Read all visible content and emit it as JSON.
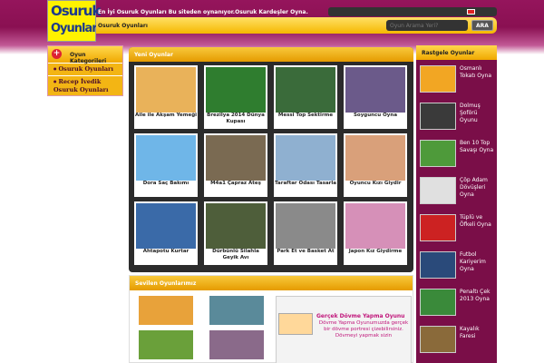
{
  "header": {
    "logo_line1": "Osuruk",
    "logo_line2": "Oyunları",
    "tagline": "En İyi Osuruk Oyunları Bu siteden oynanıyor.Osuruk Kardeşler Oyna.",
    "nav_home": "Osuruk Oyunları",
    "search_placeholder": "Oyun Arama Yeri?",
    "search_button": "ARA"
  },
  "left_sidebar": {
    "title": "Oyun Kategorileri",
    "items": [
      "Osuruk Oyunları",
      "Recep İvedik Osuruk Oyunları"
    ]
  },
  "new_games": {
    "title": "Yeni Oyunlar",
    "games": [
      {
        "name": "Aile ile Akşam Yemeği",
        "color": "#e9b25a"
      },
      {
        "name": "Brezilya 2014 Dünya Kupası",
        "color": "#2f7d2f"
      },
      {
        "name": "Messi Top Sektirme",
        "color": "#3a6b3a"
      },
      {
        "name": "Soyguncu Oyna",
        "color": "#6b5a8a"
      },
      {
        "name": "Dora Saç Bakımı",
        "color": "#6fb6e8"
      },
      {
        "name": "M4a1 Çapraz Ateş",
        "color": "#7a6a52"
      },
      {
        "name": "Taraftar Odası Tasarla",
        "color": "#8fb0d0"
      },
      {
        "name": "Oyuncu Kızı Giydir",
        "color": "#d9a07a"
      },
      {
        "name": "Ahtapotu Kurtar",
        "color": "#3a6aa8"
      },
      {
        "name": "Dürbünlü Silahla Geyik Avı",
        "color": "#4e5e3a"
      },
      {
        "name": "Park Et ve Basket At",
        "color": "#8a8a8a"
      },
      {
        "name": "Japon Kız Giydirme",
        "color": "#d690b8"
      }
    ]
  },
  "popular": {
    "title": "Sevilen Oyunlarımız",
    "feature_title": "Gerçek Dövme Yapma Oyunu",
    "feature_desc": "Dövme Yapma Oyunumuzda gerçek bir dövme portresi çizebilirsiniz. Dövmeyi yapmak sizin"
  },
  "right_sidebar": {
    "title": "Rastgele Oyunlar",
    "items": [
      {
        "name": "Osmanlı Tokatı Oyna",
        "color": "#f2a623"
      },
      {
        "name": "Dolmuş Şoförü Oyunu",
        "color": "#3a3a3a"
      },
      {
        "name": "Ben 10 Top Savaşı Oyna",
        "color": "#4e9a3a"
      },
      {
        "name": "Çöp Adam Dövüşleri Oyna",
        "color": "#e0e0e0"
      },
      {
        "name": "Tüplü ve Öfkeli Oyna",
        "color": "#c22"
      },
      {
        "name": "Futbol Kariyerim Oyna",
        "color": "#2a4a7a"
      },
      {
        "name": "Penaltı Çek 2013 Oyna",
        "color": "#3a8a3a"
      },
      {
        "name": "Kayalık Faresi",
        "color": "#8a6a3a"
      }
    ]
  }
}
